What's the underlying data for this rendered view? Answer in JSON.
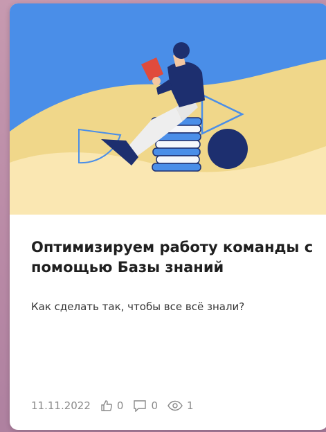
{
  "card": {
    "title": "Оптимизируем работу команды с помощью Базы знаний",
    "subtitle": "Как сделать так, чтобы все всё знали?",
    "date": "11.11.2022",
    "likes": "0",
    "comments": "0",
    "views": "1",
    "icons": {
      "likes": "thumbs-up-icon",
      "comments": "comment-icon",
      "views": "eye-icon"
    }
  },
  "colors": {
    "sky_blue": "#4a8ee8",
    "sand": "#f4dc8f",
    "sand_light": "#fbeab8",
    "navy": "#1d2f6f",
    "book_red": "#e04b3c",
    "meta_gray": "#8a8a8a"
  }
}
